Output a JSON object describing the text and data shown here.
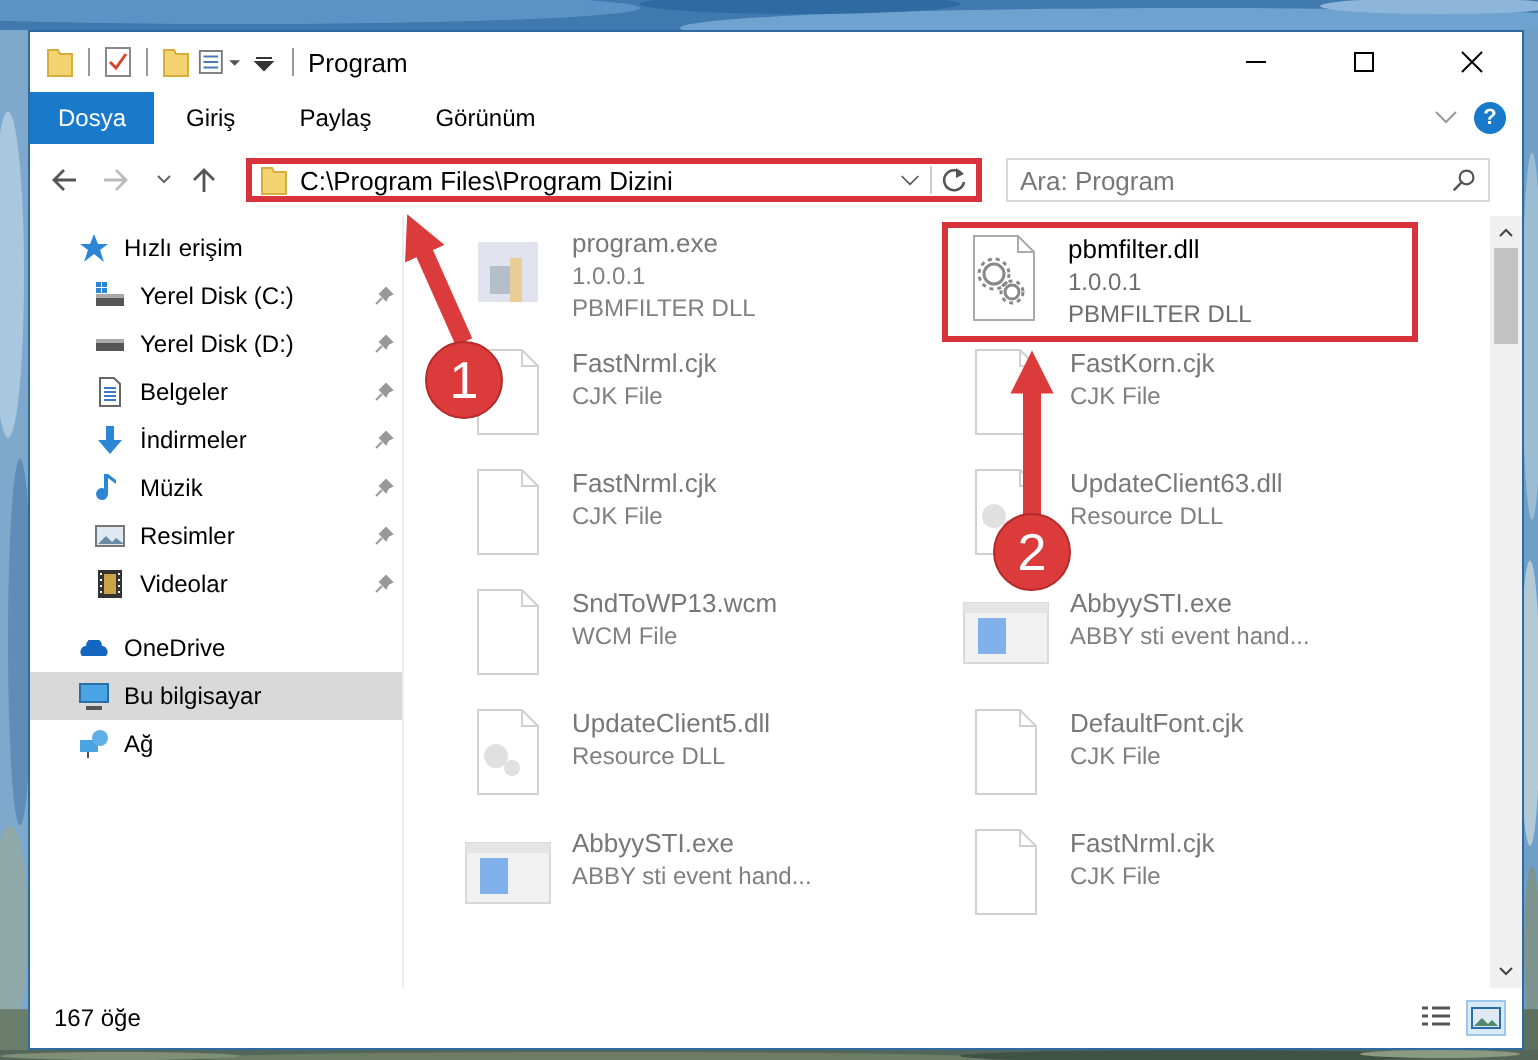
{
  "window": {
    "title": "Program"
  },
  "quick_toolbar": [
    {
      "kind": "folder"
    },
    {
      "kind": "properties"
    },
    {
      "kind": "folder"
    },
    {
      "kind": "view"
    },
    {
      "kind": "customize"
    }
  ],
  "ribbon_tabs": [
    {
      "label": "Dosya",
      "kind": "file"
    },
    {
      "label": "Giriş",
      "kind": "tab"
    },
    {
      "label": "Paylaş",
      "kind": "tab"
    },
    {
      "label": "Görünüm",
      "kind": "tab"
    }
  ],
  "help": {
    "label": "?"
  },
  "address": {
    "path": "C:\\Program Files\\Program Dizini",
    "highlighted": true
  },
  "search": {
    "placeholder": "Ara: Program"
  },
  "sidebar": {
    "items": [
      {
        "label": "Hızlı erişim",
        "kind": "star",
        "selected": false,
        "children": [
          {
            "label": "Yerel Disk (C:)",
            "kind": "disk-c",
            "selected": false,
            "pinned": true
          },
          {
            "label": "Yerel Disk (D:)",
            "kind": "disk",
            "selected": false,
            "pinned": true
          },
          {
            "label": "Belgeler",
            "kind": "docs",
            "selected": false,
            "pinned": true
          },
          {
            "label": "İndirmeler",
            "kind": "download",
            "selected": false,
            "pinned": true
          },
          {
            "label": "Müzik",
            "kind": "music",
            "selected": false,
            "pinned": true
          },
          {
            "label": "Resimler",
            "kind": "pictures",
            "selected": false,
            "pinned": true
          },
          {
            "label": "Videolar",
            "kind": "video",
            "selected": false,
            "pinned": true
          }
        ]
      },
      {
        "label": "OneDrive",
        "kind": "cloud",
        "selected": false
      },
      {
        "label": "Bu bilgisayar",
        "kind": "pc",
        "selected": true
      },
      {
        "label": "Ağ",
        "kind": "network",
        "selected": false
      }
    ]
  },
  "files": [
    {
      "name": "program.exe",
      "details": [
        "1.0.0.1",
        "PBMFILTER DLL"
      ],
      "kind": "installer",
      "highlighted": false
    },
    {
      "name": "pbmfilter.dll",
      "details": [
        "1.0.0.1",
        "PBMFILTER DLL"
      ],
      "kind": "gear",
      "highlighted": true
    },
    {
      "name": "FastNrml.cjk",
      "details": [
        "CJK File"
      ],
      "kind": "doc",
      "highlighted": false
    },
    {
      "name": "FastKorn.cjk",
      "details": [
        "CJK File"
      ],
      "kind": "doc",
      "highlighted": false
    },
    {
      "name": "FastNrml.cjk",
      "details": [
        "CJK File"
      ],
      "kind": "doc",
      "highlighted": false
    },
    {
      "name": "UpdateClient63.dll",
      "details": [
        "Resource DLL"
      ],
      "kind": "dll",
      "highlighted": false
    },
    {
      "name": "SndToWP13.wcm",
      "details": [
        "WCM File"
      ],
      "kind": "doc",
      "highlighted": false
    },
    {
      "name": "AbbyySTI.exe",
      "details": [
        "ABBY sti event hand..."
      ],
      "kind": "app",
      "highlighted": false
    },
    {
      "name": "UpdateClient5.dll",
      "details": [
        "Resource DLL"
      ],
      "kind": "dll",
      "highlighted": false
    },
    {
      "name": "DefaultFont.cjk",
      "details": [
        "CJK File"
      ],
      "kind": "doc",
      "highlighted": false
    },
    {
      "name": "AbbyySTI.exe",
      "details": [
        "ABBY sti event hand..."
      ],
      "kind": "app",
      "highlighted": false
    },
    {
      "name": "FastNrml.cjk",
      "details": [
        "CJK File"
      ],
      "kind": "doc",
      "highlighted": false
    }
  ],
  "status_bar": {
    "count": "167 öğe"
  },
  "annotations": [
    {
      "label": "1"
    },
    {
      "label": "2"
    }
  ]
}
